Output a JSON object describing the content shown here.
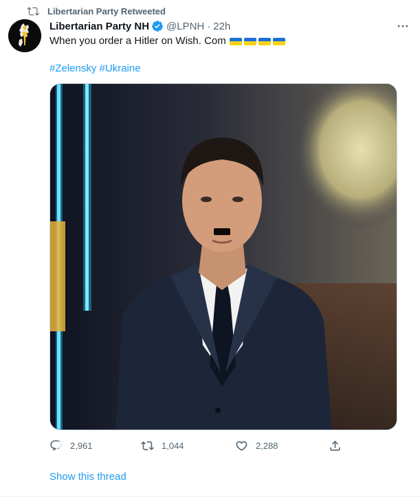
{
  "retweet": {
    "label": "Libertarian Party Retweeted",
    "icon": "retweet-icon"
  },
  "author": {
    "display_name": "Libertarian Party NH",
    "verified_icon": "verified-badge-icon",
    "handle": "@LPNH",
    "separator": "·",
    "time": "22h",
    "avatar_icon": "torch-logo-avatar"
  },
  "tweet": {
    "text": "When you order a Hitler on Wish. Com",
    "flag_icon": "ukraine-flag-emoji",
    "flag_count": 4,
    "hashtags": [
      "#Zelensky",
      "#Ukraine"
    ]
  },
  "media": {
    "icon": "tweet-photo"
  },
  "actions": {
    "reply": {
      "count": "2,961",
      "icon": "reply-icon"
    },
    "retweet": {
      "count": "1,044",
      "icon": "retweet-icon"
    },
    "like": {
      "count": "2,288",
      "icon": "heart-icon"
    },
    "share": {
      "icon": "share-icon"
    }
  },
  "show_thread": "Show this thread",
  "colors": {
    "accent": "#1d9bf0",
    "text": "#0f1419",
    "secondary": "#536471",
    "flag_blue": "#1d70d6",
    "flag_yellow": "#f7d21b"
  }
}
